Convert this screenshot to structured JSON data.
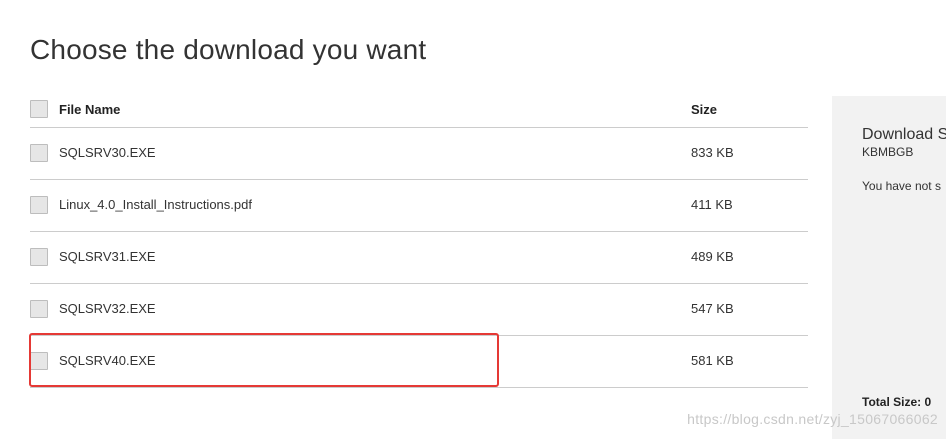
{
  "page": {
    "title": "Choose the download you want"
  },
  "table": {
    "header": {
      "file_name": "File Name",
      "size": "Size"
    },
    "rows": [
      {
        "name": "SQLSRV30.EXE",
        "size": "833 KB"
      },
      {
        "name": "Linux_4.0_Install_Instructions.pdf",
        "size": "411 KB"
      },
      {
        "name": "SQLSRV31.EXE",
        "size": "489 KB"
      },
      {
        "name": "SQLSRV32.EXE",
        "size": "547 KB"
      },
      {
        "name": "SQLSRV40.EXE",
        "size": "581 KB"
      }
    ]
  },
  "summary": {
    "title": "Download S",
    "units": "KBMBGB",
    "message": "You have not s",
    "total": "Total Size: 0"
  },
  "watermark": "https://blog.csdn.net/zyj_15067066062",
  "colors": {
    "highlight": "#e53935",
    "panel_bg": "#f2f2f2",
    "divider": "#cccccc"
  }
}
